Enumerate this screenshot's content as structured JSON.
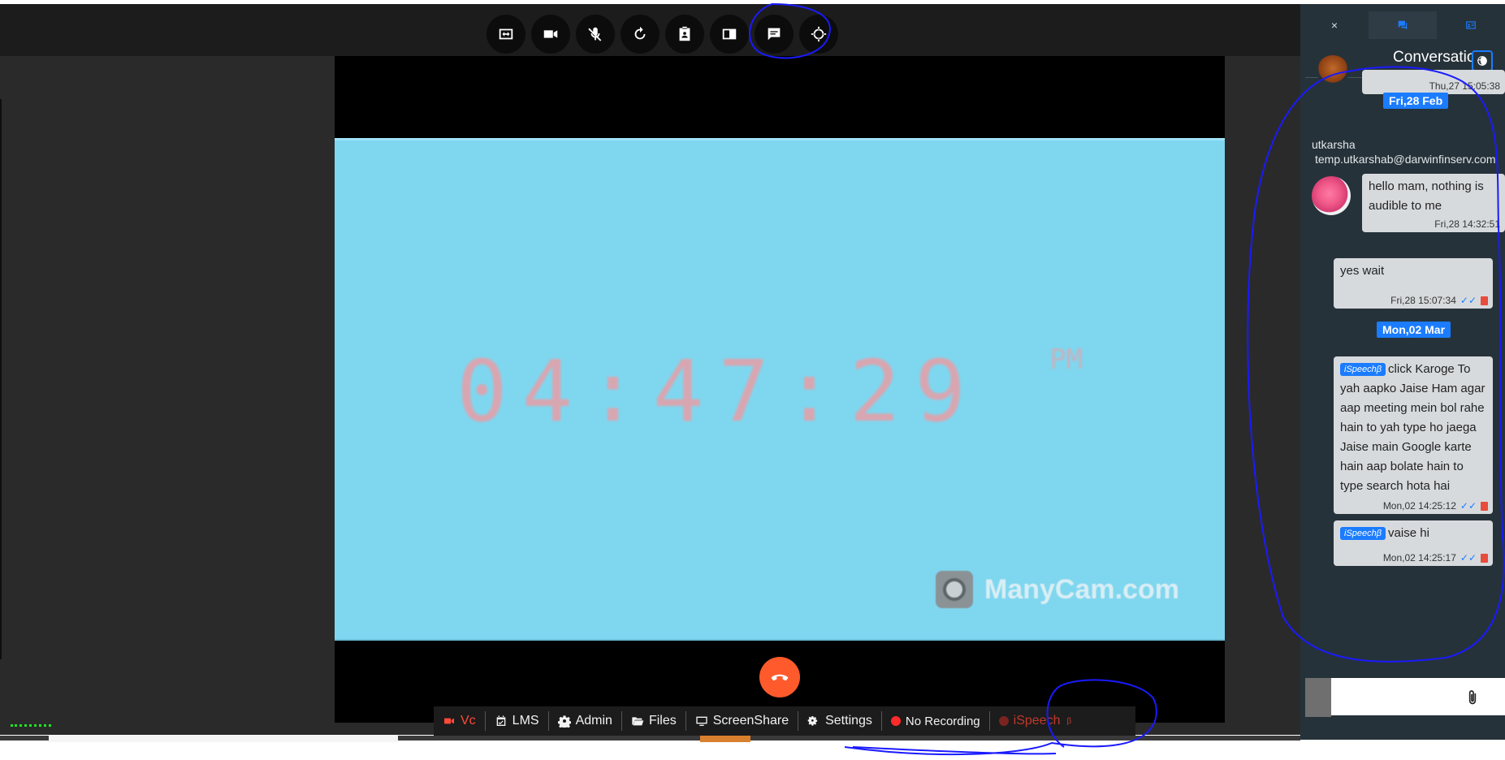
{
  "toolbar": {
    "buttons": [
      "fit-screen",
      "camera",
      "mic-off",
      "refresh",
      "contact",
      "layout",
      "chat",
      "crosshair"
    ]
  },
  "video": {
    "clock": "04:47:29",
    "clock_suffix": "PM",
    "watermark": "ManyCam.com"
  },
  "nav": {
    "vc": "Vc",
    "lms": "LMS",
    "admin": "Admin",
    "files": "Files",
    "screenshare": "ScreenShare",
    "settings": "Settings",
    "recording": "No Recording",
    "ispeech": "iSpeech",
    "ispeech_sup": "β"
  },
  "panel": {
    "tabs": [
      "×",
      "chat",
      "contacts"
    ],
    "title": "Conversation",
    "messages": {
      "m0_time": "Thu,27 15:05:38",
      "date1": "Fri,28 Feb",
      "m1_sender": "utkarsha",
      "m1_email": "temp.utkarshab@darwinfinserv.com",
      "m1_text": "hello mam, nothing is audible to me",
      "m1_time": "Fri,28 14:32:51",
      "m2_text": "yes wait",
      "m2_time": "Fri,28 15:07:34",
      "date2": "Mon,02 Mar",
      "badge": "iSpeechβ",
      "m3_text": "click Karoge To yah aapko Jaise Ham agar aap meeting mein bol rahe hain to yah type ho jaega Jaise main Google karte hain aap bolate hain to type search hota hai",
      "m3_time": "Mon,02 14:25:12",
      "m4_text": "vaise hi",
      "m4_time": "Mon,02 14:25:17",
      "ticks": "✓✓"
    },
    "input_placeholder": ""
  },
  "colors": {
    "accent": "#1b7cff",
    "hangup": "#ff5a2c",
    "active_nav": "#ff4a3a",
    "annotation_ink": "#1a1aff"
  }
}
